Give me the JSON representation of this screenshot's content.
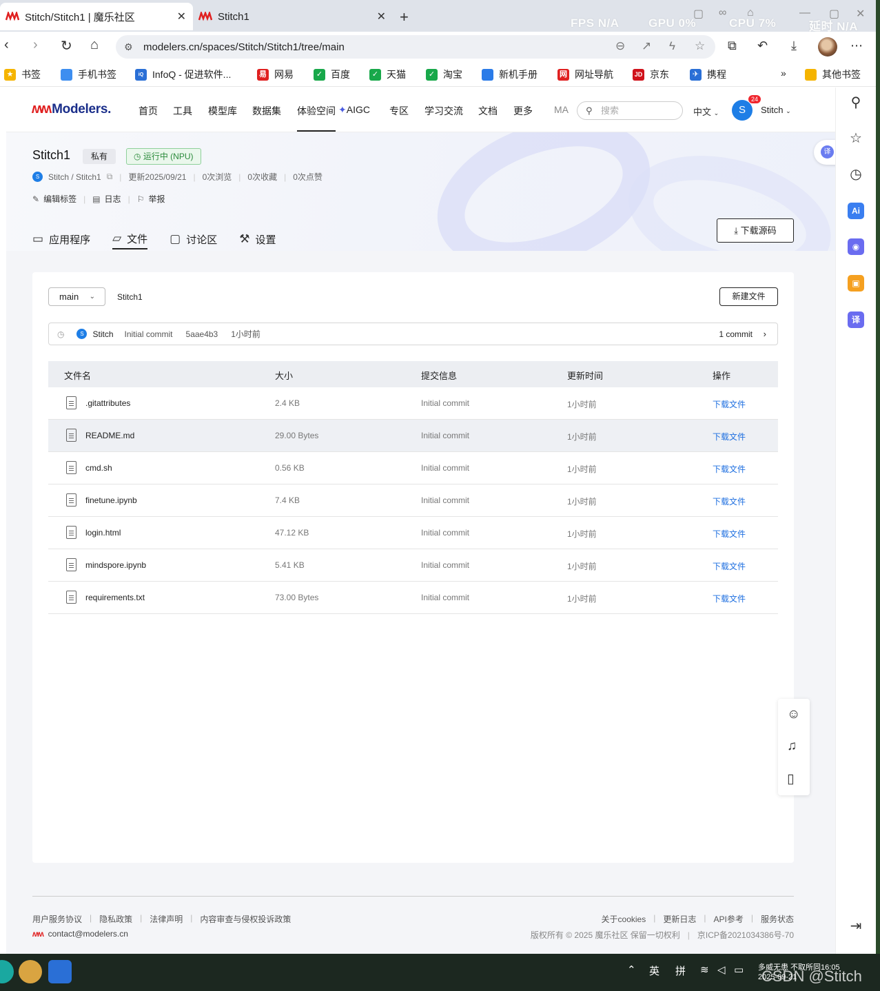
{
  "browser": {
    "tabs": [
      {
        "title": "Stitch/Stitch1 | 魔乐社区",
        "active": true
      },
      {
        "title": "Stitch1",
        "active": false
      }
    ],
    "perf": {
      "fps": "FPS N/A",
      "gpu": "GPU 0%",
      "cpu": "CPU 7%",
      "latency": "延时 N/A"
    },
    "url": "modelers.cn/spaces/Stitch/Stitch1/tree/main",
    "bookmarks": [
      {
        "label": "书签",
        "color": "#f5b400"
      },
      {
        "label": "手机书签",
        "color": "#3d8ef0"
      },
      {
        "label": "InfoQ - 促进软件...",
        "color": "#2a6fd6"
      },
      {
        "label": "网易",
        "color": "#e02020"
      },
      {
        "label": "百度",
        "color": "#18a84a"
      },
      {
        "label": "天猫",
        "color": "#18a84a"
      },
      {
        "label": "淘宝",
        "color": "#18a84a"
      },
      {
        "label": "新机手册",
        "color": "#2a7be8"
      },
      {
        "label": "网址导航",
        "color": "#e02020"
      },
      {
        "label": "京东",
        "color": "#d0121b"
      },
      {
        "label": "携程",
        "color": "#2a6fd6"
      }
    ],
    "bookmarks_more": "»",
    "bookmarks_other": "其他书签"
  },
  "site": {
    "brand": "Modelers.",
    "nav": [
      "首页",
      "工具",
      "模型库",
      "数据集",
      "体验空间",
      "AIGC",
      "专区",
      "学习交流",
      "文档",
      "更多",
      "MA"
    ],
    "search_placeholder": "搜索",
    "lang": "中文",
    "user_initial": "S",
    "badge": "24",
    "username": "Stitch"
  },
  "project": {
    "name": "Stitch1",
    "visibility": "私有",
    "status": "运行中 (NPU)",
    "owner_initial": "S",
    "path": "Stitch / Stitch1",
    "updated": "更新2025/09/21",
    "views": "0次浏览",
    "favorites": "0次收藏",
    "likes": "0次点赞",
    "actions": [
      "编辑标签",
      "日志",
      "举报"
    ],
    "tabs": [
      "应用程序",
      "文件",
      "讨论区",
      "设置"
    ],
    "download_source": "下载源码"
  },
  "files": {
    "branch": "main",
    "breadcrumb": "Stitch1",
    "new_file": "新建文件",
    "last_commit": {
      "user_initial": "S",
      "user": "Stitch",
      "message": "Initial commit",
      "hash": "5aae4b3",
      "time": "1小时前",
      "count": "1 commit"
    },
    "headers": [
      "文件名",
      "大小",
      "提交信息",
      "更新时间",
      "操作"
    ],
    "rows": [
      {
        "name": ".gitattributes",
        "size": "2.4 KB",
        "msg": "Initial commit",
        "time": "1小时前",
        "action": "下载文件"
      },
      {
        "name": "README.md",
        "size": "29.00 Bytes",
        "msg": "Initial commit",
        "time": "1小时前",
        "action": "下载文件"
      },
      {
        "name": "cmd.sh",
        "size": "0.56 KB",
        "msg": "Initial commit",
        "time": "1小时前",
        "action": "下载文件"
      },
      {
        "name": "finetune.ipynb",
        "size": "7.4 KB",
        "msg": "Initial commit",
        "time": "1小时前",
        "action": "下载文件"
      },
      {
        "name": "login.html",
        "size": "47.12 KB",
        "msg": "Initial commit",
        "time": "1小时前",
        "action": "下载文件"
      },
      {
        "name": "mindspore.ipynb",
        "size": "5.41 KB",
        "msg": "Initial commit",
        "time": "1小时前",
        "action": "下载文件"
      },
      {
        "name": "requirements.txt",
        "size": "73.00 Bytes",
        "msg": "Initial commit",
        "time": "1小时前",
        "action": "下载文件"
      }
    ]
  },
  "footer": {
    "links_left": [
      "用户服务协议",
      "隐私政策",
      "法律声明",
      "内容审查与侵权投诉政策"
    ],
    "links_right": [
      "关于cookies",
      "更新日志",
      "API参考",
      "服务状态"
    ],
    "contact": "contact@modelers.cn",
    "copyright": "版权所有 © 2025 魔乐社区 保留一切权利",
    "icp": "京ICP备2021034386号-70"
  },
  "taskbar": {
    "ime1": "英",
    "ime2": "拼",
    "watermark": "CSDN @Stitch",
    "tray_line1": "多威无患   不取所同16:05",
    "tray_line2": "2025-09-21"
  }
}
